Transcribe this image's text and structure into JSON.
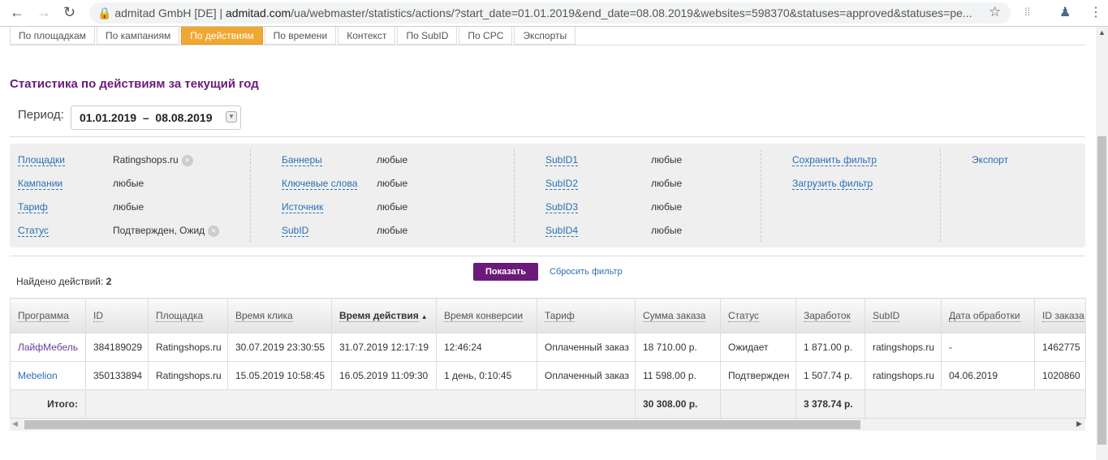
{
  "browser": {
    "site_name": "admitad GmbH [DE]",
    "url_host": "admitad.com",
    "url_path": "/ua/webmaster/statistics/actions/?start_date=01.01.2019&end_date=08.08.2019&websites=598370&statuses=approved&statuses=pe..."
  },
  "tabs": [
    {
      "label": "По площадкам"
    },
    {
      "label": "По кампаниям"
    },
    {
      "label": "По действиям",
      "active": true
    },
    {
      "label": "По времени"
    },
    {
      "label": "Контекст"
    },
    {
      "label": "По SubID"
    },
    {
      "label": "По CPC"
    },
    {
      "label": "Экспорты"
    }
  ],
  "title": "Статистика по действиям за текущий год",
  "period": {
    "label": "Период:",
    "value": "01.01.2019  –  08.08.2019"
  },
  "filters": {
    "col1": [
      {
        "label": "Площадки",
        "value": "Ratingshops.ru",
        "clear": true
      },
      {
        "label": "Кампании",
        "value": "любые"
      },
      {
        "label": "Тариф",
        "value": "любые"
      },
      {
        "label": "Статус",
        "value": "Подтвержден, Ожид",
        "clear": true
      }
    ],
    "col2": [
      {
        "label": "Баннеры",
        "value": "любые"
      },
      {
        "label": "Ключевые слова",
        "value": "любые"
      },
      {
        "label": "Источник",
        "value": "любые"
      },
      {
        "label": "SubID",
        "value": "любые"
      }
    ],
    "col3": [
      {
        "label": "SubID1",
        "value": "любые"
      },
      {
        "label": "SubID2",
        "value": "любые"
      },
      {
        "label": "SubID3",
        "value": "любые"
      },
      {
        "label": "SubID4",
        "value": "любые"
      }
    ],
    "save": "Сохранить фильтр",
    "load": "Загрузить фильтр",
    "export": "Экспорт"
  },
  "show_button": "Показать",
  "reset_link": "Сбросить фильтр",
  "found": {
    "label": "Найдено действий:",
    "count": "2"
  },
  "table": {
    "columns": [
      "Программа",
      "ID",
      "Площадка",
      "Время клика",
      "Время действия",
      "Время конверсии",
      "Тариф",
      "Сумма заказа",
      "Статус",
      "Заработок",
      "SubID",
      "Дата обработки",
      "ID заказа"
    ],
    "sorted_column": "Время действия",
    "sort_direction": "ascending",
    "rows": [
      [
        "ЛайфМебель",
        "384189029",
        "Ratingshops.ru",
        "30.07.2019 23:30:55",
        "31.07.2019 12:17:19",
        "12:46:24",
        "Оплаченный заказ",
        "18 710.00 р.",
        "Ожидает",
        "1 871.00 р.",
        "ratingshops.ru",
        "-",
        "1462775"
      ],
      [
        "Mebelion",
        "350133894",
        "Ratingshops.ru",
        "15.05.2019 10:58:45",
        "16.05.2019 11:09:30",
        "1 день, 0:10:45",
        "Оплаченный заказ",
        "11 598.00 р.",
        "Подтвержден",
        "1 507.74 р.",
        "ratingshops.ru",
        "04.06.2019",
        "1020860"
      ]
    ],
    "total": {
      "label": "Итого:",
      "order_sum": "30 308.00 р.",
      "earnings": "3 378.74 р."
    }
  }
}
